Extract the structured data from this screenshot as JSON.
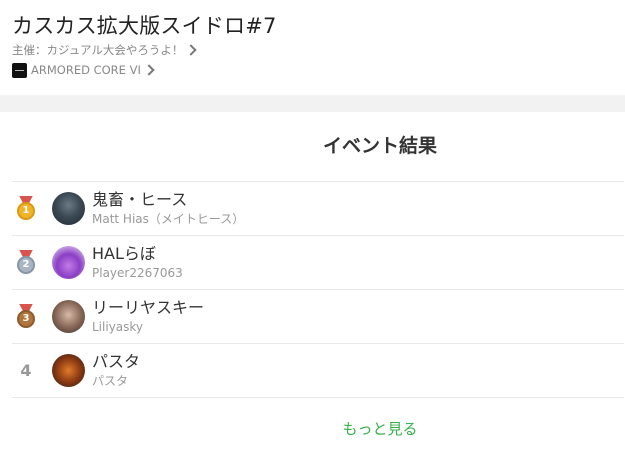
{
  "header": {
    "title": "カスカス拡大版スイドロ#7",
    "organizer": "主催：カジュアル大会やろうよ！",
    "game": "ARMORED CORE VI"
  },
  "section": {
    "title": "イベント結果"
  },
  "results": [
    {
      "rank": "1",
      "name": "鬼畜・ヒース",
      "sub": "Matt Hias（メイトヒース）",
      "medal": "gold"
    },
    {
      "rank": "2",
      "name": "HALらぼ",
      "sub": "Player2267063",
      "medal": "silver"
    },
    {
      "rank": "3",
      "name": "リーリヤスキー",
      "sub": "Liliyasky",
      "medal": "bronze"
    },
    {
      "rank": "4",
      "name": "パスタ",
      "sub": "パスタ",
      "medal": null
    }
  ],
  "more_label": "もっと見る",
  "colors": {
    "accent": "#36b14a",
    "gold": "#f0b429",
    "silver": "#a9b6c2",
    "bronze": "#b0743d"
  }
}
